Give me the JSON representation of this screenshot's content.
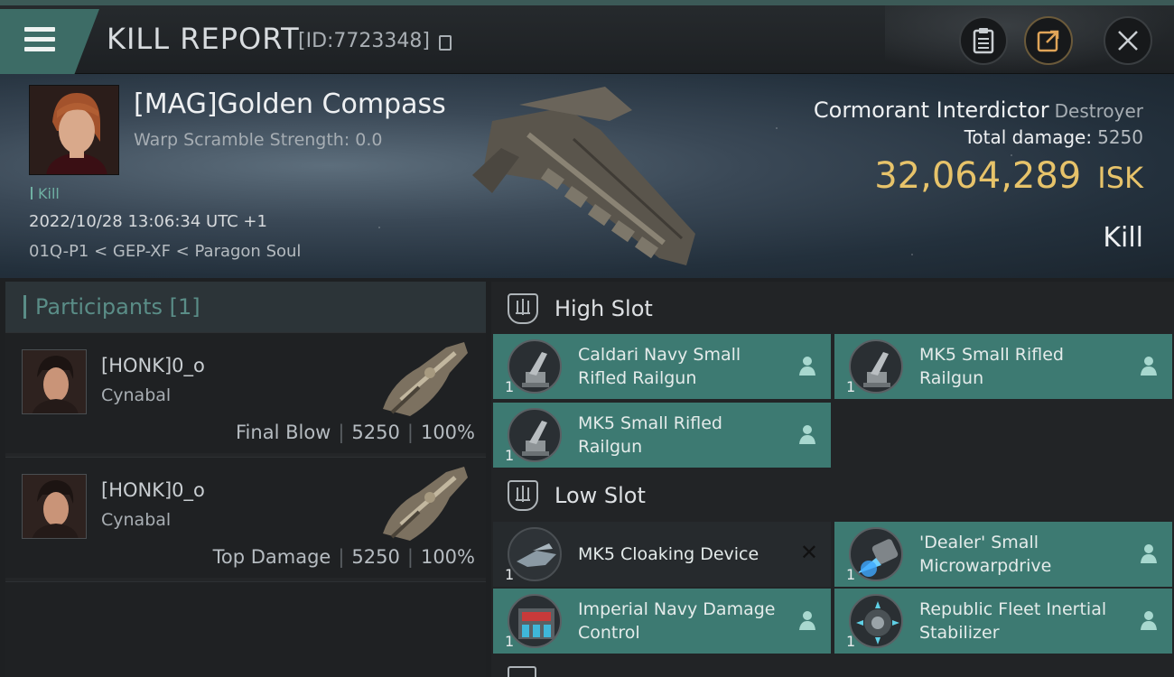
{
  "header": {
    "title": "KILL REPORT",
    "report_id": "[ID:7723348]",
    "icons": [
      "menu-icon",
      "copy-icon",
      "clipboard-icon",
      "share-icon",
      "close-icon"
    ]
  },
  "victim": {
    "name": "[MAG]Golden Compass",
    "warp_scramble": "Warp Scramble Strength: 0.0",
    "tag": "Kill",
    "timestamp": "2022/10/28 13:06:34 UTC +1",
    "location": "01Q-P1 < GEP-XF < Paragon Soul",
    "ship_name": "Cormorant Interdictor",
    "ship_class": "Destroyer",
    "total_damage_label": "Total damage:",
    "total_damage": "5250",
    "isk_value": "32,064,289",
    "isk_unit": "ISK",
    "result": "Kill"
  },
  "participants": {
    "title": "Participants",
    "count": "[1]",
    "cards": [
      {
        "name": "[HONK]0_o",
        "ship": "Cynabal",
        "role": "Final Blow",
        "damage": "5250",
        "percent": "100%"
      },
      {
        "name": "[HONK]0_o",
        "ship": "Cynabal",
        "role": "Top Damage",
        "damage": "5250",
        "percent": "100%"
      }
    ]
  },
  "fitting": {
    "high_slot": {
      "label": "High Slot",
      "modules": [
        {
          "name": "Caldari Navy Small Rifled Railgun",
          "qty": "1",
          "status": "dropped"
        },
        {
          "name": "MK5 Small Rifled Railgun",
          "qty": "1",
          "status": "dropped"
        },
        {
          "name": "MK5 Small Rifled Railgun",
          "qty": "1",
          "status": "dropped"
        }
      ]
    },
    "low_slot": {
      "label": "Low Slot",
      "modules": [
        {
          "name": "MK5 Cloaking Device",
          "qty": "1",
          "status": "destroyed"
        },
        {
          "name": "'Dealer' Small Microwarpdrive",
          "qty": "1",
          "status": "dropped"
        },
        {
          "name": "Imperial Navy Damage Control",
          "qty": "1",
          "status": "dropped"
        },
        {
          "name": "Republic Fleet Inertial Stabilizer",
          "qty": "1",
          "status": "dropped"
        }
      ]
    }
  },
  "colors": {
    "accent": "#3d7a72",
    "isk": "#e7c36a",
    "kill_tag": "#6fb0a3"
  }
}
